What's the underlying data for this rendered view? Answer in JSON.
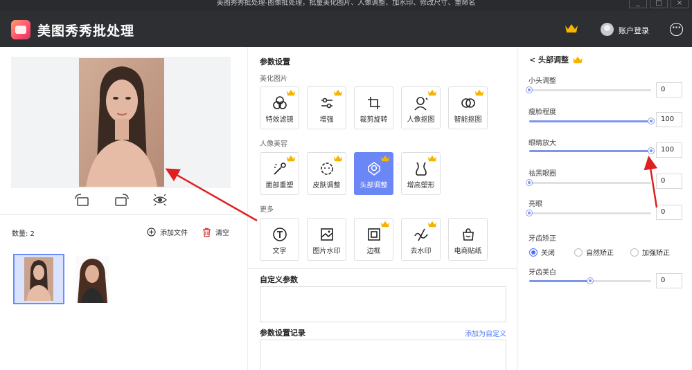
{
  "window": {
    "title": "美图秀秀批处理-图像批处理，批量美化图片、人像调整、加水印、修改尺寸、重命名",
    "controls": [
      "_",
      "□",
      "×"
    ]
  },
  "header": {
    "app_name": "美图秀秀批处理",
    "login_label": "账户登录",
    "more_label": "···"
  },
  "left": {
    "count_label": "数量: 2",
    "add_file_label": "添加文件",
    "clear_label": "清空"
  },
  "middle": {
    "section_title": "参数设置",
    "groups": [
      {
        "title": "美化图片",
        "tools": [
          {
            "label": "特效滤镜",
            "icon": "filter-icon",
            "vip": true
          },
          {
            "label": "增强",
            "icon": "enhance-icon",
            "vip": true
          },
          {
            "label": "裁剪旋转",
            "icon": "crop-icon",
            "vip": false
          },
          {
            "label": "人像抠图",
            "icon": "portrait-cutout-icon",
            "vip": true
          },
          {
            "label": "智能抠图",
            "icon": "smart-cutout-icon",
            "vip": true
          }
        ]
      },
      {
        "title": "人像美容",
        "tools": [
          {
            "label": "面部重塑",
            "icon": "face-reshape-icon",
            "vip": true
          },
          {
            "label": "皮肤调整",
            "icon": "skin-icon",
            "vip": true
          },
          {
            "label": "头部调整",
            "icon": "head-adjust-icon",
            "vip": true,
            "active": true
          },
          {
            "label": "增高塑形",
            "icon": "body-shape-icon",
            "vip": true
          }
        ]
      },
      {
        "title": "更多",
        "tools": [
          {
            "label": "文字",
            "icon": "text-icon",
            "vip": false
          },
          {
            "label": "图片水印",
            "icon": "image-watermark-icon",
            "vip": false
          },
          {
            "label": "边框",
            "icon": "border-icon",
            "vip": true
          },
          {
            "label": "去水印",
            "icon": "remove-watermark-icon",
            "vip": true
          },
          {
            "label": "电商贴纸",
            "icon": "sticker-icon",
            "vip": false
          }
        ]
      }
    ],
    "custom_params_title": "自定义参数",
    "history_title": "参数设置记录",
    "add_custom_link": "添加为自定义"
  },
  "right": {
    "back_title": "< 头部调整",
    "sliders": [
      {
        "label": "小头调整",
        "value": "0",
        "level": 0
      },
      {
        "label": "瘦脸程度",
        "value": "100",
        "level": 1
      },
      {
        "label": "眼睛放大",
        "value": "100",
        "level": 1
      },
      {
        "label": "祛黑眼圈",
        "value": "0",
        "level": 0
      },
      {
        "label": "亮眼",
        "value": "0",
        "level": 0
      }
    ],
    "teeth_label": "牙齿矫正",
    "teeth_options": [
      {
        "label": "关闭",
        "selected": true
      },
      {
        "label": "自然矫正",
        "selected": false
      },
      {
        "label": "加强矫正",
        "selected": false
      }
    ],
    "whitening": {
      "label": "牙齿美白",
      "value": "0",
      "level": 0.5
    }
  },
  "colors": {
    "accent": "#6b86f5",
    "crown": "#f5b400",
    "arrow": "#e02020",
    "header_bg": "#2e2f33"
  }
}
